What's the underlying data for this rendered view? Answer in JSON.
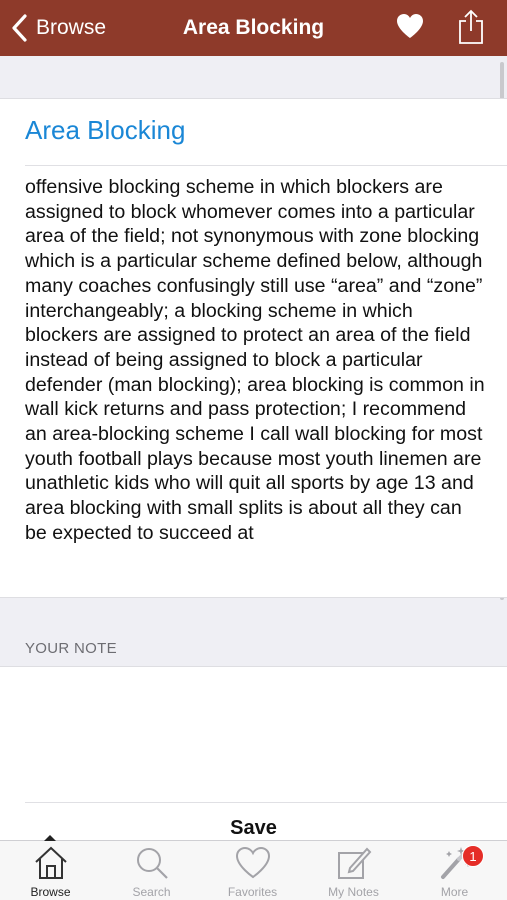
{
  "navbar": {
    "back_label": "Browse",
    "title": "Area Blocking",
    "bg_color": "#8e3a2a",
    "heart_icon": "heart-icon",
    "share_icon": "share-icon"
  },
  "entry": {
    "title": "Area Blocking",
    "title_color": "#1a87d6",
    "definition": "offensive blocking scheme in which blockers are assigned to block whomever comes into a particular area of the field; not synonymous with zone blocking which is a particular scheme defined below, although many coaches confusingly still use “area” and “zone” interchangeably; a blocking scheme in which blockers are assigned to protect an area of the field instead of being assigned to block a particular defender (man blocking); area blocking is common in wall kick returns and pass protection; I recommend an area-blocking scheme I call wall blocking for most youth football plays because most youth linemen are unathletic kids who will quit all sports by age 13 and area blocking with small splits is about all they can be expected to succeed at"
  },
  "note": {
    "section_label": "YOUR NOTE",
    "value": "",
    "save_label": "Save"
  },
  "tabs": [
    {
      "label": "Browse",
      "icon": "house-icon",
      "active": true
    },
    {
      "label": "Search",
      "icon": "magnifier-icon",
      "active": false
    },
    {
      "label": "Favorites",
      "icon": "heart-outline-icon",
      "active": false
    },
    {
      "label": "My Notes",
      "icon": "note-pencil-icon",
      "active": false
    },
    {
      "label": "More",
      "icon": "magic-wand-icon",
      "active": false,
      "badge": "1"
    }
  ]
}
